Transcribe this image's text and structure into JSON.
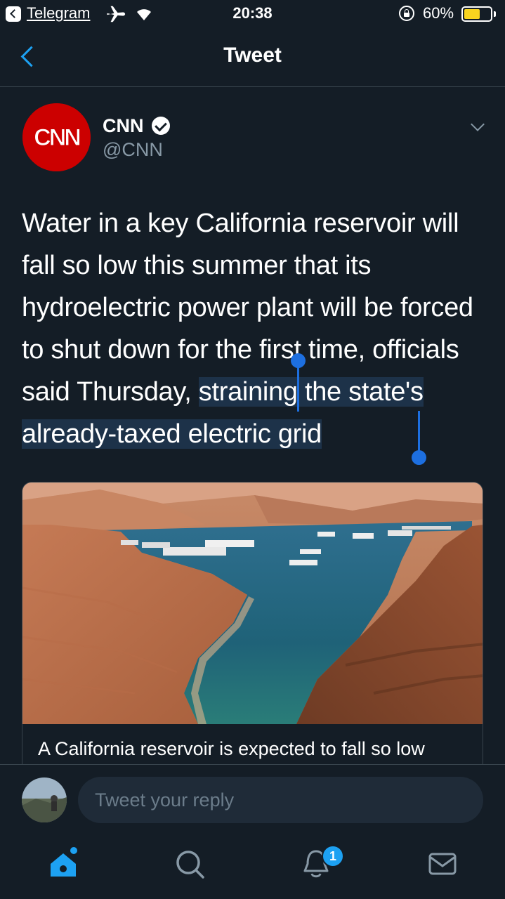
{
  "status_bar": {
    "back_app": "Telegram",
    "time": "20:38",
    "battery_pct": "60%",
    "battery_level": 0.6,
    "icons": [
      "back-to-app-icon",
      "airplane-icon",
      "wifi-icon",
      "orientation-lock-icon",
      "battery-icon"
    ]
  },
  "nav": {
    "title": "Tweet",
    "back_icon": "chevron-left-icon"
  },
  "tweet": {
    "author_name": "CNN",
    "author_handle": "@CNN",
    "avatar_text": "CNN",
    "text_before_selection": "Water in a key California reservoir will fall so low this summer that its hydroelectric power plant will be forced to shut down for the first time, officials said Thursday, ",
    "text_selected": "straining the state's already-taxed electric grid",
    "card": {
      "caption": "A California reservoir is expected to fall so low"
    }
  },
  "reply": {
    "placeholder": "Tweet your reply"
  },
  "tabbar": {
    "items": [
      "home-icon",
      "search-icon",
      "notifications-icon",
      "messages-icon"
    ],
    "notification_badge": "1"
  },
  "colors": {
    "background": "#141d26",
    "accent": "#1da1f2",
    "selection": "#1d3249",
    "cnn_red": "#cc0000",
    "battery": "#f8d41f"
  }
}
